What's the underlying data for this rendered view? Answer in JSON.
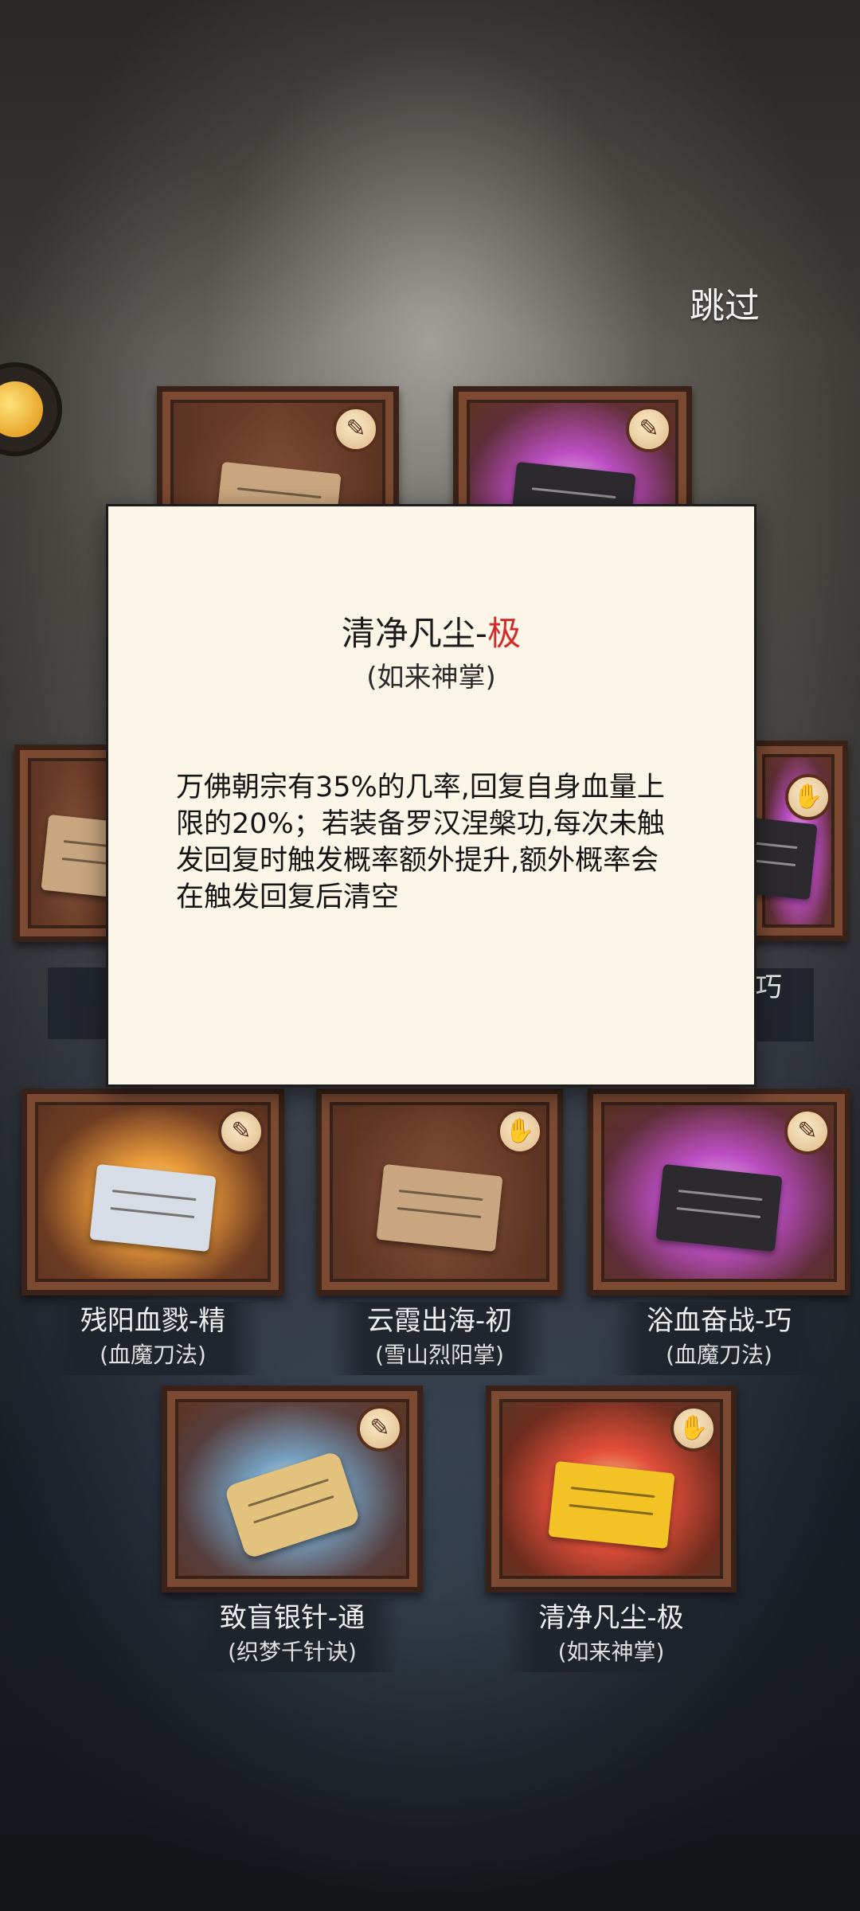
{
  "header": {
    "skip_label": "跳过"
  },
  "popup": {
    "title_name": "清净凡尘-",
    "title_grade": "极",
    "subtitle": "(如来神掌)",
    "description": "万佛朝宗有35%的几率,回复自身血量上限的20%；若装备罗汉涅槃功,每次未触发回复时触发概率额外提升,额外概率会在触发回复后清空",
    "grade_color": "#d42a2a"
  },
  "items": [
    {
      "name": "残阳血戮-精",
      "art": "(血魔刀法)",
      "glow": "gold",
      "icon": "blade-icon"
    },
    {
      "name": "云霞出海-初",
      "art": "(雪山烈阳掌)",
      "glow": "plain",
      "icon": "palm-icon"
    },
    {
      "name": "浴血奋战-巧",
      "art": "(血魔刀法)",
      "glow": "purple",
      "icon": "blade-icon"
    },
    {
      "name": "致盲银针-通",
      "art": "(织梦千针诀)",
      "glow": "blue",
      "icon": "needle-icon"
    },
    {
      "name": "清净凡尘-极",
      "art": "(如来神掌)",
      "glow": "red",
      "icon": "palm-icon"
    }
  ],
  "partial_labels": {
    "right_mid": "巧"
  }
}
